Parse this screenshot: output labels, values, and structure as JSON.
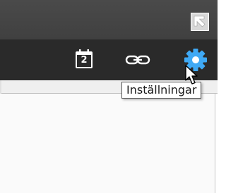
{
  "window": {
    "restore_icon": "restore-window-icon"
  },
  "toolbar": {
    "calendar": {
      "icon": "calendar-icon",
      "day": "2"
    },
    "link": {
      "icon": "link-icon"
    },
    "settings": {
      "icon": "gear-icon",
      "active_color": "#3fa9f5"
    }
  },
  "tooltip": {
    "text": "Inställningar"
  },
  "colors": {
    "top_bar": "#444444",
    "toolbar": "#2a2a2a",
    "accent": "#3fa9f5",
    "panel": "#fafafa"
  }
}
